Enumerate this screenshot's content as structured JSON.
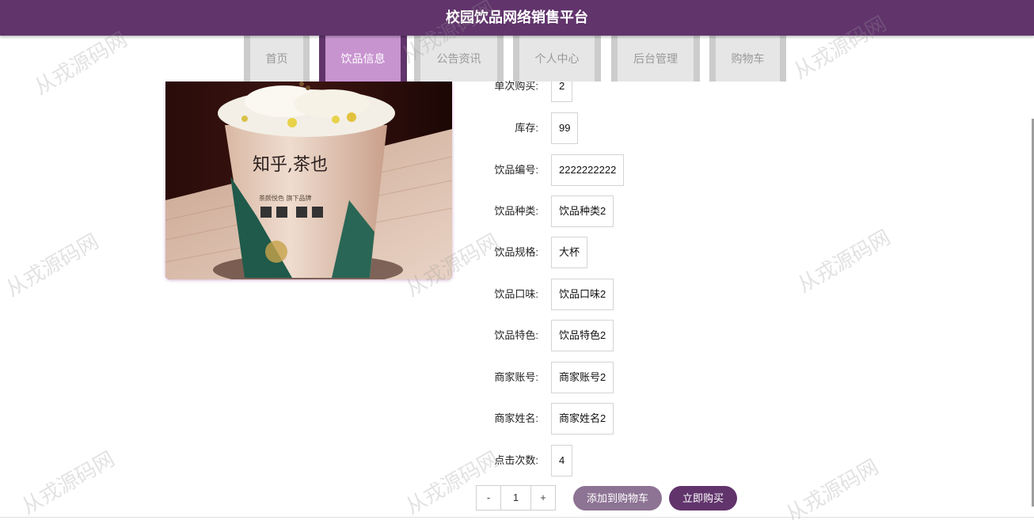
{
  "header": {
    "title": "校园饮品网络销售平台"
  },
  "nav": {
    "items": [
      {
        "label": "首页"
      },
      {
        "label": "饮品信息"
      },
      {
        "label": "公告资讯"
      },
      {
        "label": "个人中心"
      },
      {
        "label": "后台管理"
      },
      {
        "label": "购物车"
      }
    ],
    "active_index": 1
  },
  "product_image": {
    "icon": "drink-cup-image",
    "cup_brand_text": "知乎,茶也",
    "cup_sub_text": "茶颜悦色 旗下品牌"
  },
  "details": [
    {
      "label": "单次购买:",
      "value": "2"
    },
    {
      "label": "库存:",
      "value": "99"
    },
    {
      "label": "饮品编号:",
      "value": "2222222222"
    },
    {
      "label": "饮品种类:",
      "value": "饮品种类2"
    },
    {
      "label": "饮品规格:",
      "value": "大杯"
    },
    {
      "label": "饮品口味:",
      "value": "饮品口味2"
    },
    {
      "label": "饮品特色:",
      "value": "饮品特色2"
    },
    {
      "label": "商家账号:",
      "value": "商家账号2"
    },
    {
      "label": "商家姓名:",
      "value": "商家姓名2"
    },
    {
      "label": "点击次数:",
      "value": "4"
    }
  ],
  "quantity": {
    "minus": "-",
    "value": "1",
    "plus": "+"
  },
  "actions": {
    "add_to_cart": "添加到购物车",
    "buy_now": "立即购买"
  },
  "watermark": {
    "text": "从戎源码网"
  },
  "colors": {
    "primary": "#61346c",
    "active_tab": "#c894d0",
    "cart_button": "#8d7394"
  }
}
